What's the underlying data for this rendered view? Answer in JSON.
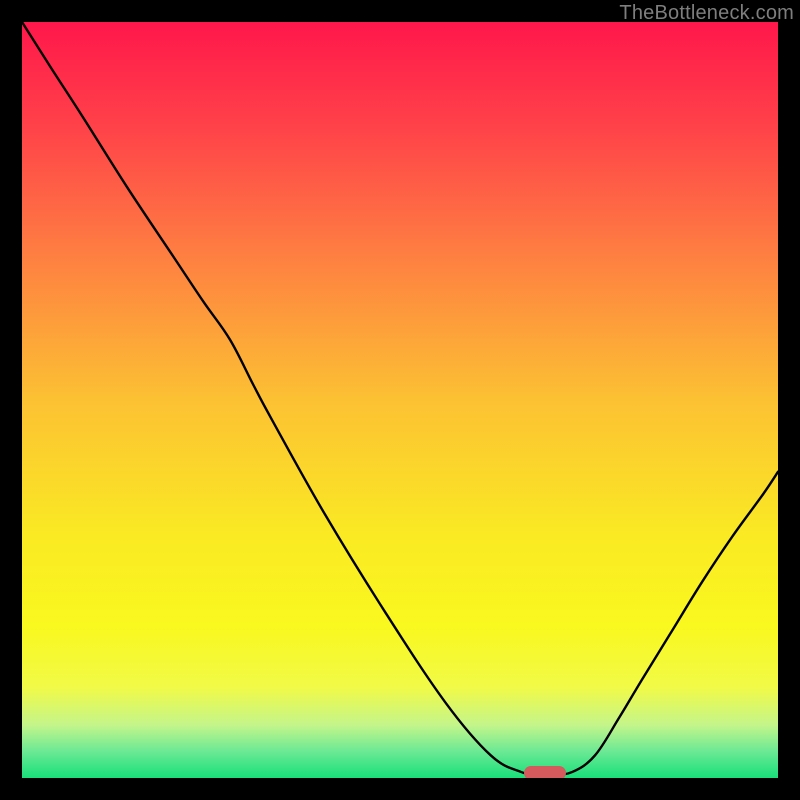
{
  "watermark": "TheBottleneck.com",
  "chart_data": {
    "type": "line",
    "title": "",
    "xlabel": "",
    "ylabel": "",
    "xlim": [
      0,
      100
    ],
    "ylim": [
      0,
      100
    ],
    "grid": false,
    "legend": false,
    "background": {
      "type": "vertical-gradient",
      "stops": [
        {
          "pos": 0.0,
          "color": "#ff174b"
        },
        {
          "pos": 0.14,
          "color": "#ff4249"
        },
        {
          "pos": 0.3,
          "color": "#fe7c42"
        },
        {
          "pos": 0.5,
          "color": "#fcc133"
        },
        {
          "pos": 0.68,
          "color": "#faea23"
        },
        {
          "pos": 0.8,
          "color": "#f9f81f"
        },
        {
          "pos": 0.88,
          "color": "#f1fa47"
        },
        {
          "pos": 0.93,
          "color": "#c4f58a"
        },
        {
          "pos": 0.965,
          "color": "#6be994"
        },
        {
          "pos": 1.0,
          "color": "#18e07a"
        }
      ]
    },
    "series": [
      {
        "name": "bottleneck-curve",
        "x": [
          0.0,
          3.8,
          8.0,
          14.0,
          20.0,
          24.0,
          27.5,
          30.6,
          33.0,
          40.0,
          48.0,
          56.0,
          62.0,
          66.0,
          68.3,
          70.0,
          72.8,
          75.8,
          79.0,
          82.0,
          86.0,
          90.0,
          94.0,
          98.0,
          100.0
        ],
        "y": [
          100.0,
          94.0,
          87.5,
          78.0,
          69.0,
          63.0,
          58.0,
          52.0,
          47.5,
          35.0,
          22.0,
          10.0,
          3.0,
          0.8,
          0.4,
          0.4,
          0.8,
          3.0,
          8.0,
          13.0,
          19.5,
          26.0,
          32.0,
          37.5,
          40.5
        ]
      }
    ],
    "marker": {
      "name": "optimal-range",
      "x_center": 69.2,
      "width_pct": 5.5,
      "y_pct_from_bottom": 0.6,
      "color": "#d45a5e"
    }
  }
}
